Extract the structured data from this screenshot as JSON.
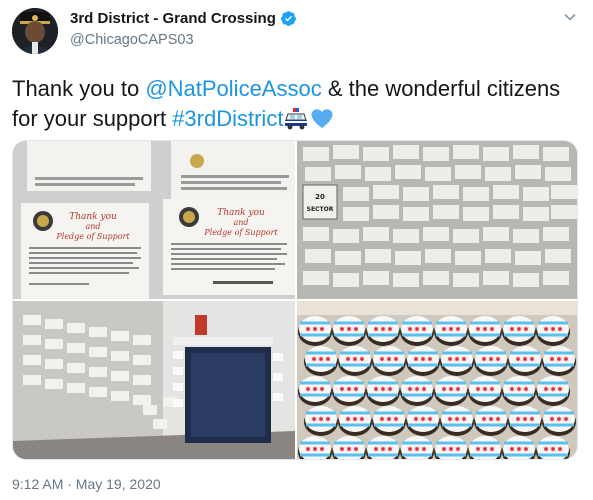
{
  "author": {
    "display_name": "3rd District - Grand Crossing",
    "handle": "@ChicagoCAPS03",
    "verified": true
  },
  "tweet": {
    "text_part1": "Thank you to ",
    "mention": "@NatPoliceAssoc",
    "text_part2": " & the wonderful citizens for your support ",
    "hashtag": "#3rdDistrict",
    "emojis": [
      "police-car-emoji",
      "blue-heart-emoji"
    ]
  },
  "media": {
    "images": [
      {
        "name": "pledge-cards-photo",
        "card_title_line1": "Thank you",
        "card_title_line2": "and",
        "card_title_line3": "Pledge of Support"
      },
      {
        "name": "wall-of-cards-photo",
        "sign_number": "20",
        "sign_label": "SECTOR"
      },
      {
        "name": "hallway-cards-photo"
      },
      {
        "name": "chicago-flag-cupcakes-photo"
      }
    ]
  },
  "timestamp": "9:12 AM · May 19, 2020",
  "colors": {
    "link": "#1b95e0",
    "verified_badge": "#1da1f2",
    "secondary_text": "#657786",
    "flag_blue": "#5bc0eb",
    "flag_red": "#e32636"
  }
}
